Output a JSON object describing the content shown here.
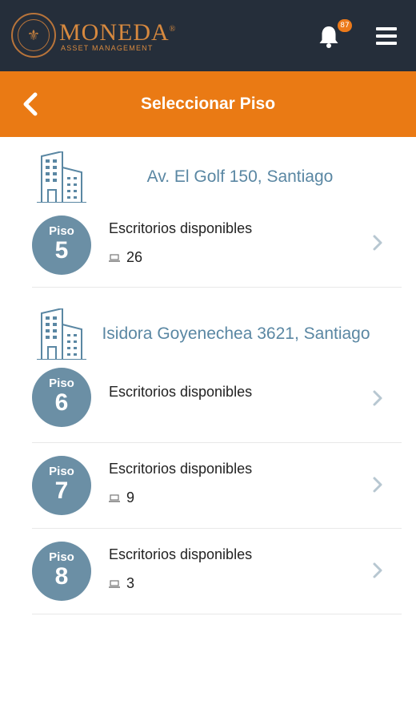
{
  "brand": {
    "name": "MONEDA",
    "registered": "®",
    "subtitle": "ASSET MANAGEMENT"
  },
  "notifications": {
    "count": "87"
  },
  "header": {
    "title": "Seleccionar Piso"
  },
  "buildings": [
    {
      "name": "Av. El Golf 150, Santiago",
      "floors": [
        {
          "label": "Piso",
          "number": "5",
          "desk_label": "Escritorios disponibles",
          "count": "26"
        }
      ]
    },
    {
      "name": "Isidora Goyenechea 3621, Santiago",
      "floors": [
        {
          "label": "Piso",
          "number": "6",
          "desk_label": "Escritorios disponibles",
          "count": ""
        },
        {
          "label": "Piso",
          "number": "7",
          "desk_label": "Escritorios disponibles",
          "count": "9"
        },
        {
          "label": "Piso",
          "number": "8",
          "desk_label": "Escritorios disponibles",
          "count": "3"
        }
      ]
    }
  ],
  "colors": {
    "topbar": "#252e3a",
    "accent": "#ea7a14",
    "brand_gold": "#d7893f",
    "floor_circle": "#6b8fa5",
    "building_text": "#5a87a3"
  },
  "icons": {
    "back": "chevron-left-icon",
    "bell": "bell-icon",
    "menu": "hamburger-menu-icon",
    "building": "building-icon",
    "desk": "laptop-icon",
    "row_arrow": "chevron-right-icon"
  }
}
